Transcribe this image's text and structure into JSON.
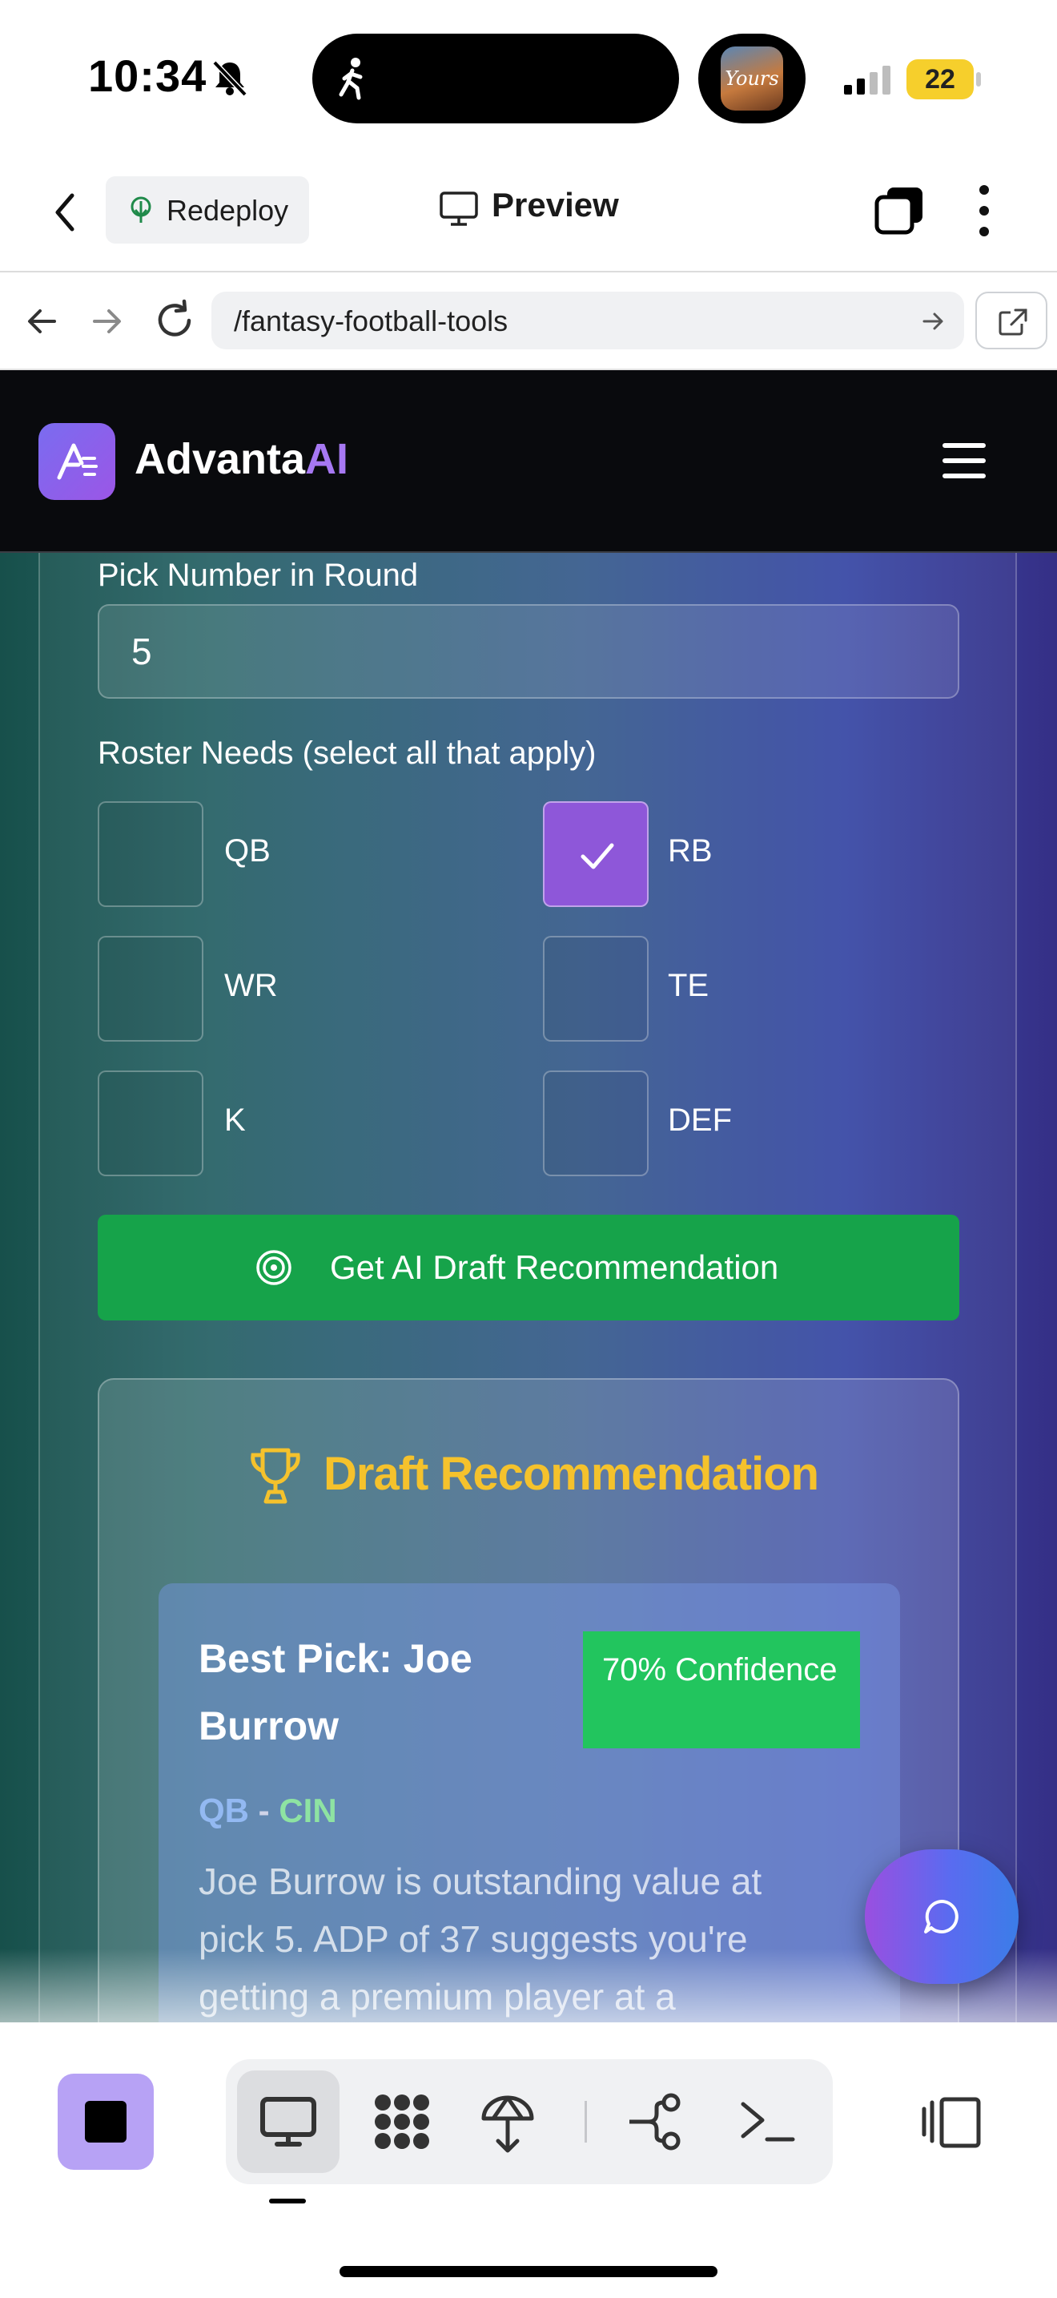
{
  "status_bar": {
    "time": "10:34",
    "island_album_text": "Yours",
    "battery": "22",
    "icons": [
      "bell-slash-icon",
      "walking-icon",
      "signal-icon"
    ]
  },
  "header": {
    "redeploy_label": "Redeploy",
    "preview_label": "Preview",
    "icons": [
      "chevron-left-icon",
      "redeploy-icon",
      "monitor-icon",
      "tabs-icon",
      "more-vertical-icon"
    ]
  },
  "urlbar": {
    "url": "/fantasy-football-tools",
    "icons": [
      "arrow-left-icon",
      "arrow-right-icon",
      "reload-icon",
      "arrow-go-icon",
      "external-link-icon"
    ]
  },
  "app": {
    "brand_main": "Advanta",
    "brand_ai": "AI",
    "accent": "#a678f2",
    "pick_label": "Pick Number in Round",
    "pick_value": "5",
    "roster_label": "Roster Needs (select all that apply)",
    "positions": [
      {
        "label": "QB",
        "checked": false
      },
      {
        "label": "RB",
        "checked": true
      },
      {
        "label": "WR",
        "checked": false
      },
      {
        "label": "TE",
        "checked": false
      },
      {
        "label": "K",
        "checked": false
      },
      {
        "label": "DEF",
        "checked": false
      }
    ],
    "get_button": "Get AI Draft Recommendation",
    "get_button_color": "#16a34a",
    "recommendation": {
      "title": "Draft Recommendation",
      "title_color": "#f5c22c",
      "best_pick": "Best Pick: Joe Burrow",
      "confidence": "70% Confidence",
      "position": "QB",
      "separator": "-",
      "team": "CIN",
      "description": "Joe Burrow is outstanding value at pick 5. ADP of 37 suggests you're getting a premium player at a"
    }
  },
  "toolbar": {
    "items": [
      "stop-icon",
      "monitor-icon",
      "workspace-grid-icon",
      "deploy-icon",
      "git-branch-icon",
      "terminal-icon",
      "panel-icon"
    ],
    "active": "monitor-icon"
  }
}
